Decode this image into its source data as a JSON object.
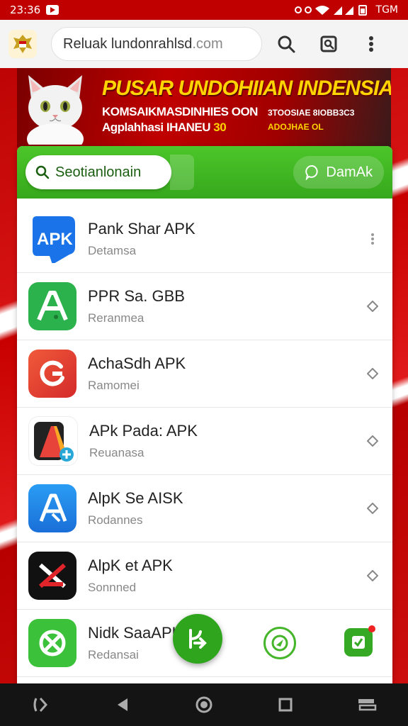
{
  "status": {
    "time": "23:36",
    "right_text": "TGM"
  },
  "browser": {
    "url_main": "Reluak lundonrahlsd",
    "url_tld": " .com",
    "icons": [
      "search-icon",
      "reader-icon",
      "more-vert-icon"
    ]
  },
  "banner": {
    "title": "PUSAR UNDOHIIAN INDENSIAN",
    "line1": "KOMSAIKMASDINHIES OON",
    "line2_a": "Agplahhasi IHANEU ",
    "line2_b": "30",
    "side1": "3TOOSIAE 8IOBB3C3",
    "side2": "ADOJHAE OL"
  },
  "toolbar": {
    "search_label": "Seotianlonain",
    "download_label": "DamAk"
  },
  "apps": [
    {
      "name": "Pank Shar APK",
      "sub": "Detamsa",
      "icon": "apk-badge-icon",
      "action": "more-icon"
    },
    {
      "name": "PPR Sa. GBB",
      "sub": "Reranmea",
      "icon": "android-a-icon",
      "action": "diamond-icon"
    },
    {
      "name": "AchaSdh APK",
      "sub": "Ramomei",
      "icon": "refresh-g-icon",
      "action": "diamond-icon"
    },
    {
      "name": "APk Pada: APK",
      "sub": "Reuanasa",
      "icon": "gradient-a-icon",
      "action": "diamond-icon"
    },
    {
      "name": "AlpK Se AISK",
      "sub": "Rodannes",
      "icon": "app-store-a-icon",
      "action": "diamond-icon"
    },
    {
      "name": "AlpK et APK",
      "sub": "Sonnned",
      "icon": "x-mark-icon",
      "action": "diamond-icon"
    },
    {
      "name": "Nidk SaaAPK",
      "sub": "Redansai",
      "icon": "cross-box-icon",
      "action": "none"
    }
  ],
  "colors": {
    "accent_green": "#3cb41f",
    "banner_red": "#c00000",
    "banner_yellow": "#ffd400"
  }
}
